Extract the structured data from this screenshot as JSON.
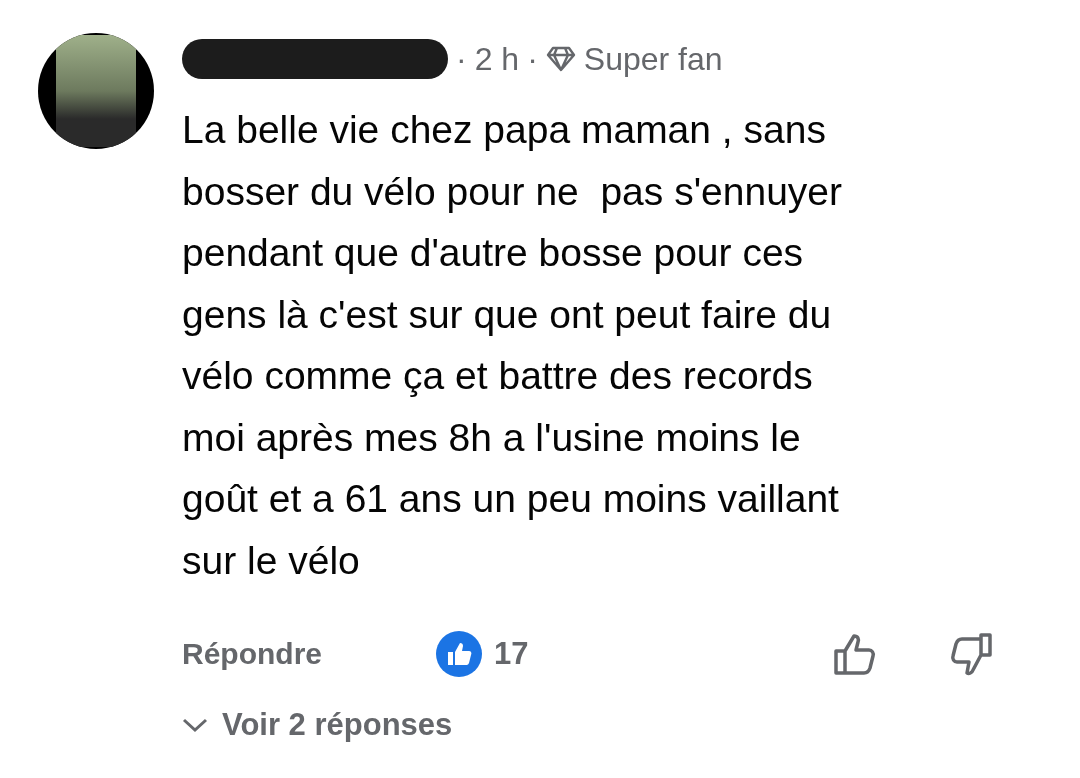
{
  "comment": {
    "separator": "·",
    "time": "2 h",
    "badge": "Super fan",
    "text": "La belle vie chez papa maman , sans\nbosser du vélo pour ne  pas s'ennuyer\npendant que d'autre bosse pour ces\ngens là c'est sur que ont peut faire du\nvélo comme ça et battre des records\nmoi après mes 8h a l'usine moins le\ngoût et a 61 ans un peu moins vaillant\nsur le vélo",
    "reply_label": "Répondre",
    "like_count": "17",
    "view_replies": "Voir 2 réponses"
  }
}
